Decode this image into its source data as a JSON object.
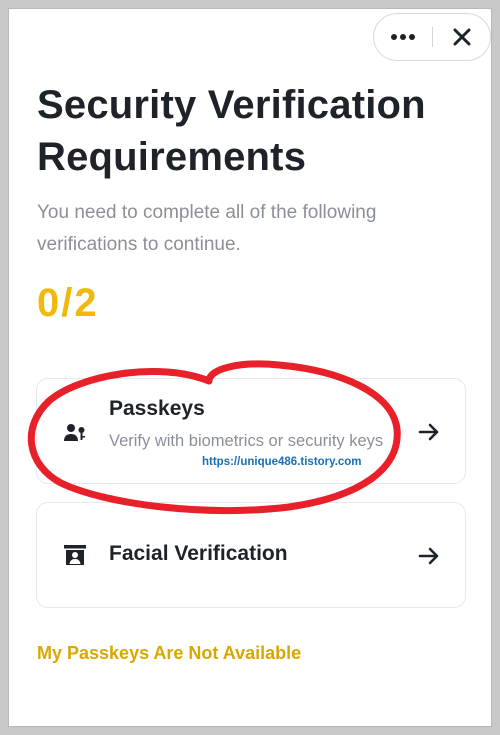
{
  "header": {
    "more_icon": "more-horizontal-icon",
    "close_icon": "close-icon"
  },
  "title": "Security Verification Requirements",
  "subtitle": "You need to complete all of the following verifications to continue.",
  "progress": {
    "text": "0/2",
    "completed": 0,
    "total": 2
  },
  "methods": [
    {
      "title": "Passkeys",
      "description": "Verify with biometrics or security keys",
      "icon": "passkey-person-icon"
    },
    {
      "title": "Facial Verification",
      "icon": "face-scan-icon"
    }
  ],
  "fallback_link": "My Passkeys Are Not Available",
  "watermark": "https://unique486.tistory.com",
  "colors": {
    "accent": "#F0B90B",
    "link": "#D8A800",
    "title": "#1E2329",
    "muted": "#8A9099",
    "annotation": "#E8202A"
  }
}
